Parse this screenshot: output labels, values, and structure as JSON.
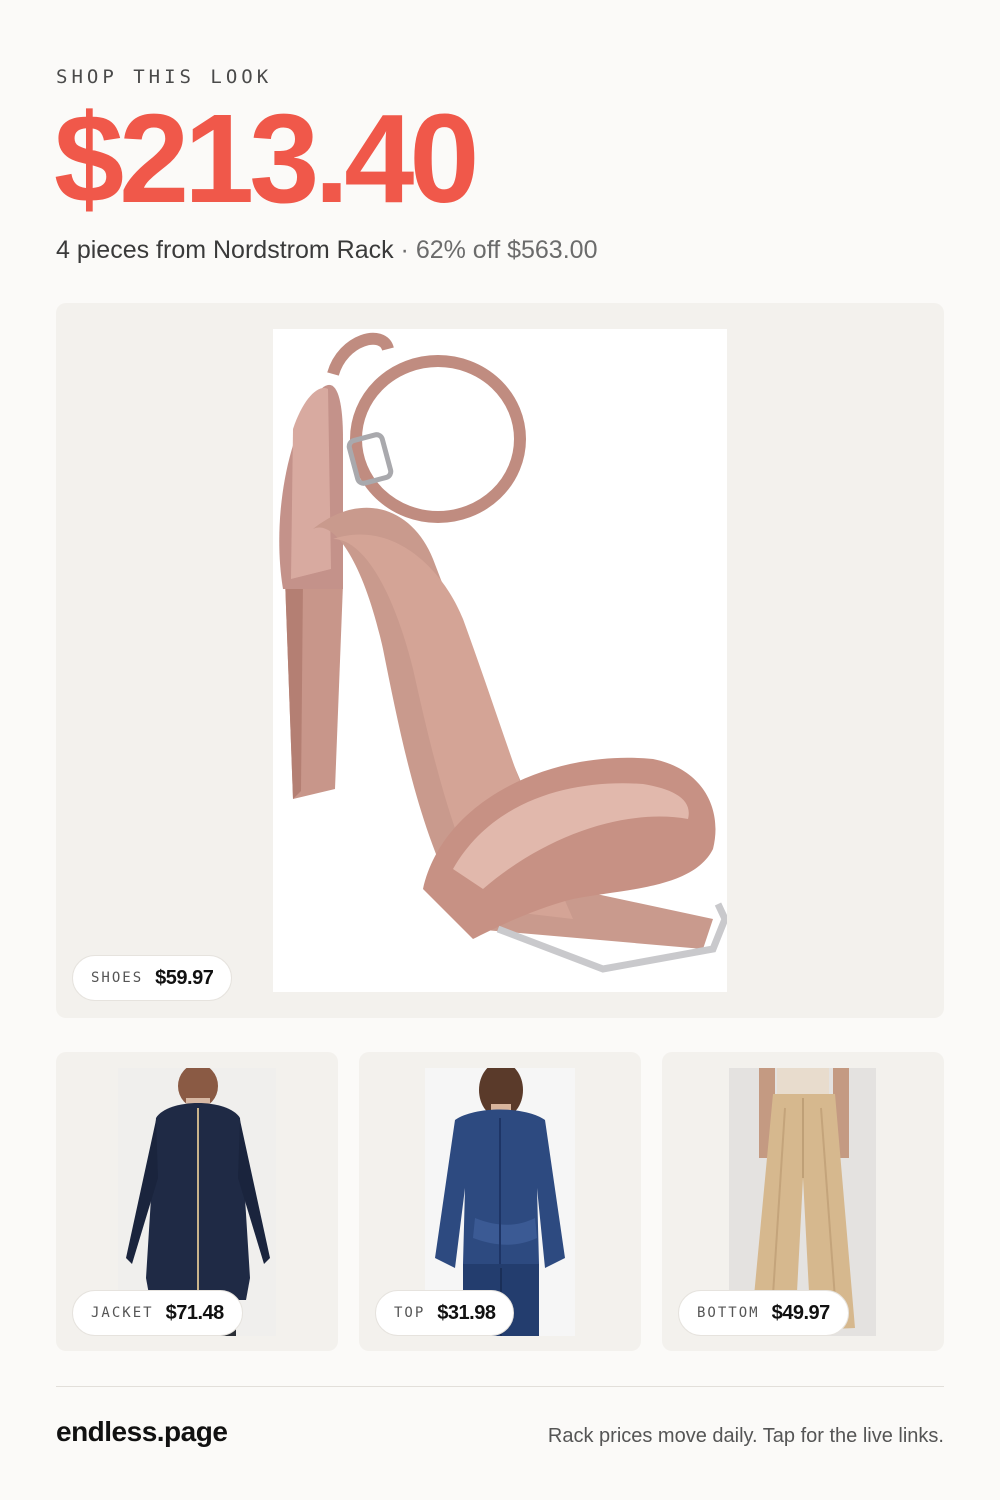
{
  "header": {
    "eyebrow": "SHOP THIS LOOK",
    "total_price": "$213.40",
    "pieces_text": "4 pieces from Nordstrom Rack",
    "separator": " · ",
    "discount_text": "62% off $563.00"
  },
  "items": [
    {
      "label": "SHOES",
      "price": "$59.97",
      "image": "sandal-image"
    },
    {
      "label": "JACKET",
      "price": "$71.48",
      "image": "jacket-image"
    },
    {
      "label": "TOP",
      "price": "$31.98",
      "image": "denim-shirt-image"
    },
    {
      "label": "BOTTOM",
      "price": "$49.97",
      "image": "trousers-image"
    }
  ],
  "footer": {
    "brand": "endless.page",
    "note": "Rack prices move daily. Tap for the live links."
  },
  "colors": {
    "accent": "#f0584a",
    "background": "#fbfaf8",
    "card": "#f3f1ed"
  }
}
